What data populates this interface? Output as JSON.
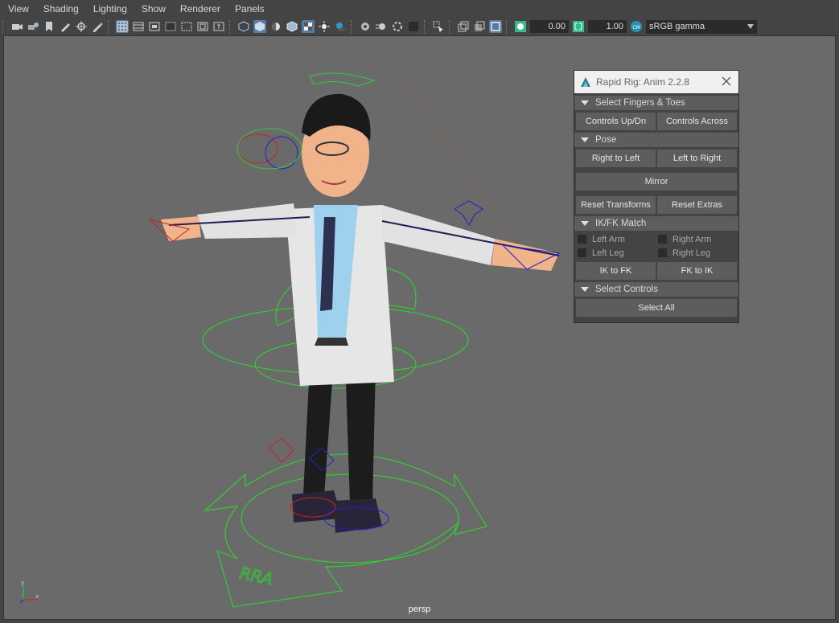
{
  "menubar": {
    "items": [
      "View",
      "Shading",
      "Lighting",
      "Show",
      "Renderer",
      "Panels"
    ]
  },
  "toolbar": {
    "field_1": "0.00",
    "field_2": "1.00",
    "color_space": "sRGB gamma"
  },
  "viewport": {
    "camera_label": "persp",
    "ground_text": "RRA",
    "axis_x": "x",
    "axis_y": "y"
  },
  "rig_panel": {
    "title": "Rapid Rig: Anim 2.2.8",
    "sections": {
      "fingers": {
        "header": "Select Fingers & Toes",
        "btn_updn": "Controls Up/Dn",
        "btn_across": "Controls Across"
      },
      "pose": {
        "header": "Pose",
        "btn_r2l": "Right to Left",
        "btn_l2r": "Left to Right",
        "btn_mirror": "Mirror",
        "btn_reset_transforms": "Reset Transforms",
        "btn_reset_extras": "Reset Extras"
      },
      "ikfk": {
        "header": "IK/FK Match",
        "left_arm": "Left Arm",
        "right_arm": "Right Arm",
        "left_leg": "Left Leg",
        "right_leg": "Right Leg",
        "btn_ik_to_fk": "IK to FK",
        "btn_fk_to_ik": "FK to IK"
      },
      "select": {
        "header": "Select Controls",
        "btn_select_all": "Select All"
      }
    }
  },
  "colors": {
    "accent": "#5a7ba0",
    "viewport_bg": "#6a6a6a",
    "rig_green": "#33cc33",
    "rig_blue": "#2020cc",
    "rig_red": "#cc2020"
  }
}
